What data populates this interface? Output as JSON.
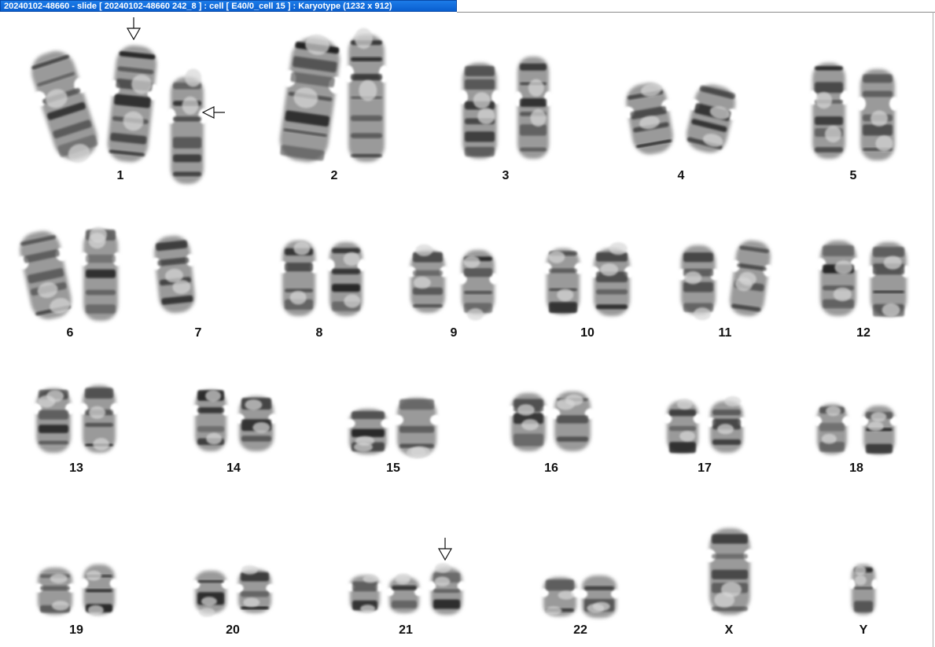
{
  "window": {
    "title": "20240102-48660 - slide [ 20240102-48660 242_8 ] : cell [ E40/0_cell 15 ] : Karyotype  (1232 x 912)"
  },
  "karyotype": {
    "groups": [
      {
        "label": "1",
        "count": 3
      },
      {
        "label": "2",
        "count": 2
      },
      {
        "label": "3",
        "count": 2
      },
      {
        "label": "4",
        "count": 2
      },
      {
        "label": "5",
        "count": 2
      },
      {
        "label": "6",
        "count": 2
      },
      {
        "label": "7",
        "count": 1
      },
      {
        "label": "8",
        "count": 2
      },
      {
        "label": "9",
        "count": 2
      },
      {
        "label": "10",
        "count": 2
      },
      {
        "label": "11",
        "count": 2
      },
      {
        "label": "12",
        "count": 2
      },
      {
        "label": "13",
        "count": 2
      },
      {
        "label": "14",
        "count": 2
      },
      {
        "label": "15",
        "count": 2
      },
      {
        "label": "16",
        "count": 2
      },
      {
        "label": "17",
        "count": 2
      },
      {
        "label": "18",
        "count": 2
      },
      {
        "label": "19",
        "count": 2
      },
      {
        "label": "20",
        "count": 2
      },
      {
        "label": "21",
        "count": 3
      },
      {
        "label": "22",
        "count": 2
      },
      {
        "label": "X",
        "count": 1
      },
      {
        "label": "Y",
        "count": 1
      }
    ],
    "arrows": [
      {
        "group": "1",
        "direction": "down"
      },
      {
        "group": "1",
        "direction": "left"
      },
      {
        "group": "21",
        "direction": "down"
      }
    ]
  }
}
